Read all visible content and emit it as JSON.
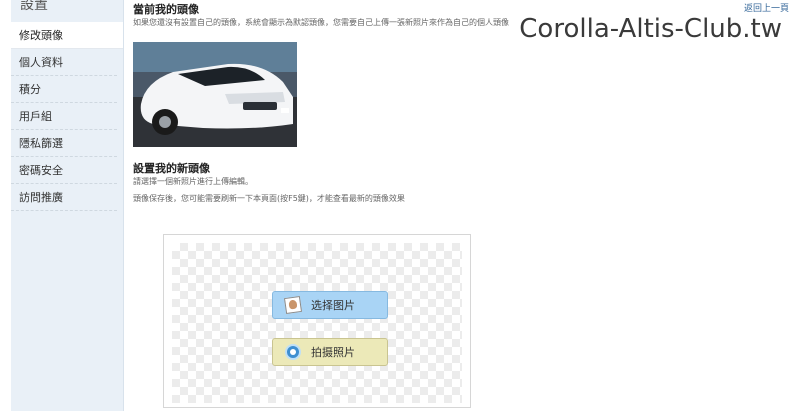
{
  "sidebar": {
    "title": "設置",
    "items": [
      {
        "label": "修改頭像",
        "active": true
      },
      {
        "label": "個人資料"
      },
      {
        "label": "積分"
      },
      {
        "label": "用戶組"
      },
      {
        "label": "隱私篩選"
      },
      {
        "label": "密碼安全"
      },
      {
        "label": "訪問推廣"
      }
    ]
  },
  "header": {
    "back_link": "返回上一頁",
    "watermark": "Corolla-Altis-Club.tw"
  },
  "current_avatar": {
    "title": "當前我的頭像",
    "description": "如果您還沒有設置自己的頭像，系統會顯示為默認頭像，您需要自己上傳一張新照片來作為自己的個人頭像"
  },
  "new_avatar": {
    "title": "設置我的新頭像",
    "instruction": "請選擇一個新照片進行上傳編輯。",
    "note": "頭像保存後，您可能需要刷新一下本頁面(按F5鍵)，才能查看最新的頭像效果"
  },
  "uploader": {
    "select_label": "选择图片",
    "camera_label": "拍摄照片"
  },
  "colors": {
    "sidebar_bg": "#e9f0f7",
    "select_button": "#a9d4f5",
    "camera_button": "#ece9b8",
    "link": "#336699"
  },
  "icons": {
    "select": "photo-icon",
    "camera": "webcam-icon"
  }
}
